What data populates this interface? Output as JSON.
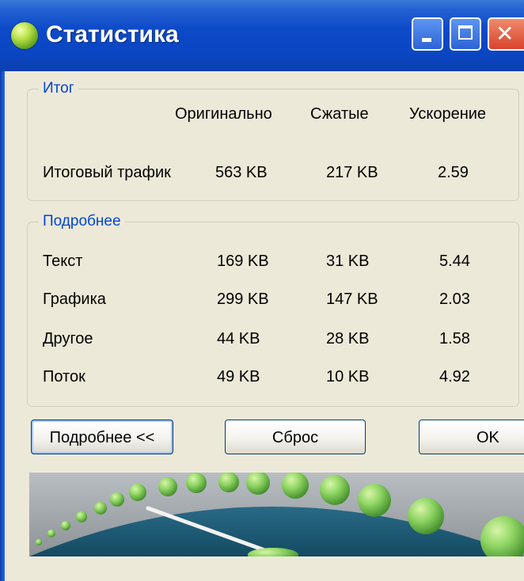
{
  "window": {
    "title": "Статистика",
    "accent_color": "#0a46c3",
    "controls": [
      "minimize-icon",
      "maximize-icon",
      "close-icon"
    ]
  },
  "summary": {
    "legend": "Итог",
    "headers": {
      "original": "Оригинально",
      "compressed": "Сжатые",
      "speedup": "Ускорение"
    },
    "total": {
      "label": "Итоговый трафик",
      "original": "563 KB",
      "compressed": "217 KB",
      "speedup": "2.59"
    }
  },
  "details": {
    "legend": "Подробнее",
    "rows": [
      {
        "label": "Текст",
        "original": "169 KB",
        "compressed": "31 KB",
        "speedup": "5.44"
      },
      {
        "label": "Графика",
        "original": "299 KB",
        "compressed": "147 KB",
        "speedup": "2.03"
      },
      {
        "label": "Другое",
        "original": "44 KB",
        "compressed": "28 KB",
        "speedup": "1.58"
      },
      {
        "label": "Поток",
        "original": "49 KB",
        "compressed": "10 KB",
        "speedup": "4.92"
      }
    ]
  },
  "buttons": {
    "details": "Подробнее <<",
    "reset": "Сброс",
    "ok": "OK"
  },
  "gauge": {
    "dial_color": "#1f5a74",
    "dot_color": "#7cc85a"
  }
}
